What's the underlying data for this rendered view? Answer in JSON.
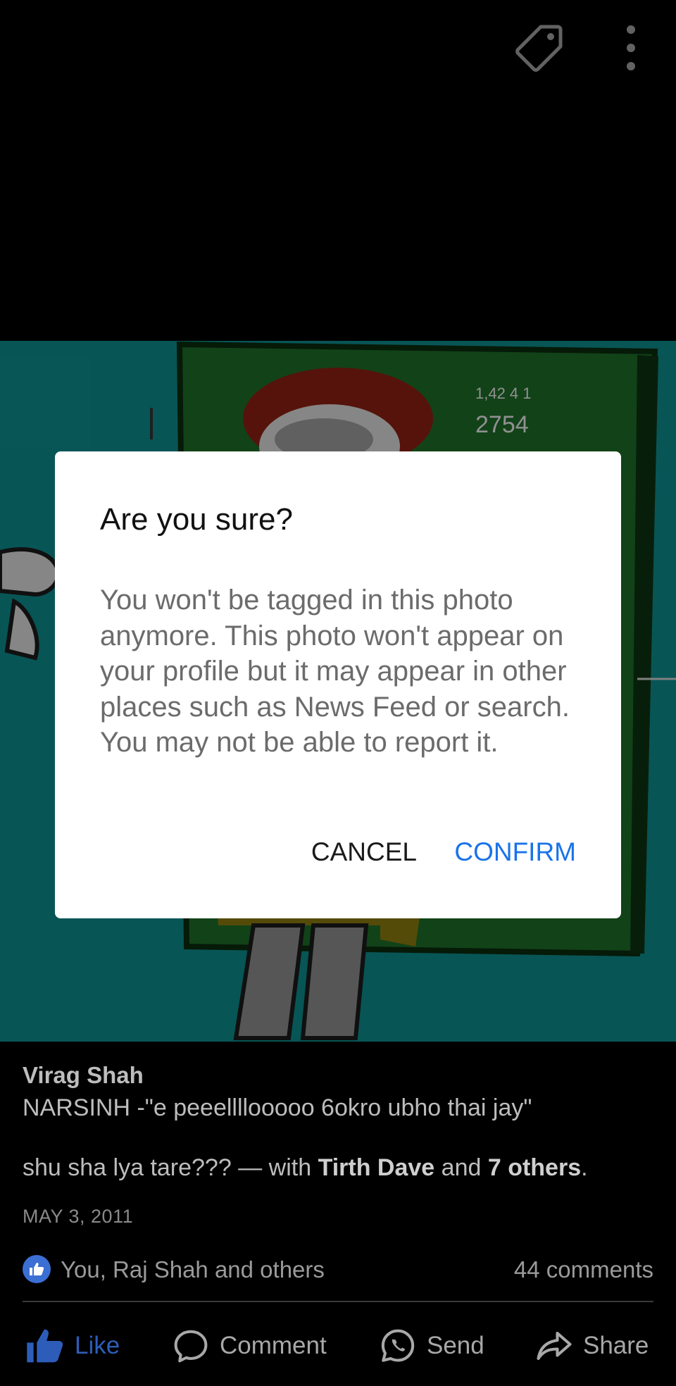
{
  "topbar": {
    "icons": [
      "tag-icon",
      "more-vertical-icon"
    ]
  },
  "photo": {
    "blackboard_scribble_line1": "1,42 4 1",
    "blackboard_scribble_line2": "2754"
  },
  "dialog": {
    "title": "Are you sure?",
    "body": "You won't be tagged in this photo anymore. This photo won't appear on your profile but it may appear in other places such as News Feed or search. You may not be able to report it.",
    "cancel_label": "CANCEL",
    "confirm_label": "CONFIRM"
  },
  "post": {
    "author": "Virag Shah",
    "caption_line1": "NARSINH -\"e peeellllooooo 6okro ubho thai jay\"",
    "caption_line2_prefix": "shu sha lya tare??? — with ",
    "tagged_name": "Tirth Dave",
    "and_text": " and ",
    "others_text": "7 others",
    "period": ".",
    "date": "MAY 3, 2011",
    "reactions_text": "You, Raj Shah and others",
    "comments_text": "44 comments"
  },
  "actions": {
    "like": "Like",
    "comment": "Comment",
    "send": "Send",
    "share": "Share"
  },
  "colors": {
    "background": "#000000",
    "accent_blue": "#1a73e8",
    "like_blue": "#2d5db8",
    "photo_teal": "#0e8a8c",
    "blackboard_green": "#1d6b28"
  }
}
